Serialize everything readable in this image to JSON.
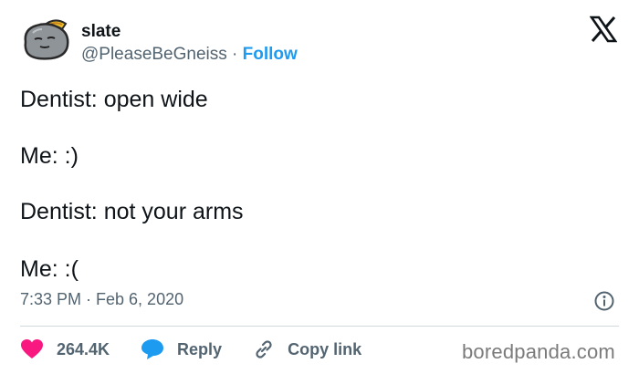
{
  "author": {
    "display_name": "slate",
    "handle": "@PleaseBeGneiss",
    "separator": " · ",
    "follow_label": "Follow"
  },
  "tweet": {
    "lines": [
      "Dentist: open wide",
      "Me: :)",
      "Dentist: not your arms",
      "Me: :("
    ],
    "timestamp": "7:33 PM · Feb 6, 2020"
  },
  "actions": {
    "likes": "264.4K",
    "reply_label": "Reply",
    "copy_link_label": "Copy link"
  },
  "watermark": "boredpanda.com",
  "icons": {
    "avatar": "rock-avatar-icon",
    "platform": "x-logo-icon",
    "info": "info-icon",
    "like": "heart-icon",
    "reply": "speech-bubble-icon",
    "copy_link": "link-icon"
  },
  "colors": {
    "text": "#0f1419",
    "secondary": "#536471",
    "accent": "#1d9bf0",
    "like": "#f91880",
    "divider": "#cfd9de"
  }
}
